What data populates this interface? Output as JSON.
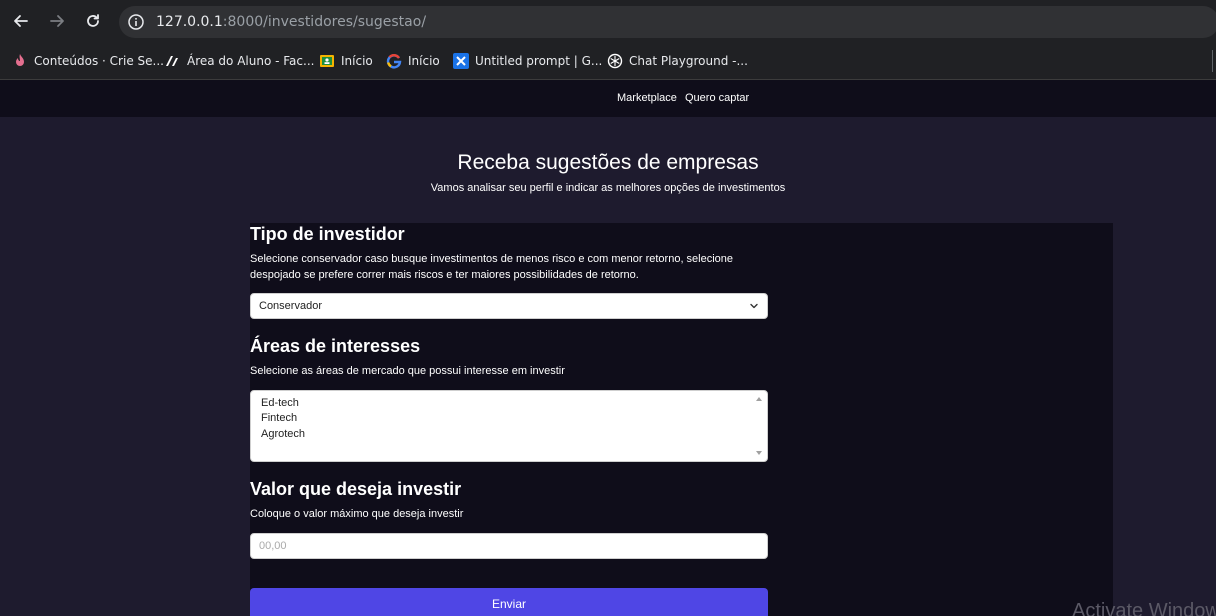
{
  "browser": {
    "url_host": "127.0.0.1",
    "url_path": ":8000/investidores/sugestao/",
    "bookmarks": [
      {
        "label": "Conteúdos · Crie Se...",
        "icon": "flame-icon"
      },
      {
        "label": "Área do Aluno - Fac...",
        "icon": "logo-icon"
      },
      {
        "label": "Início",
        "icon": "classroom-icon"
      },
      {
        "label": "Início",
        "icon": "google-icon"
      },
      {
        "label": "Untitled prompt | G...",
        "icon": "ai-studio-icon"
      },
      {
        "label": "Chat Playground -...",
        "icon": "openai-icon"
      }
    ]
  },
  "nav": {
    "links": [
      "Marketplace",
      "Quero captar"
    ]
  },
  "header": {
    "title": "Receba sugestões de empresas",
    "subtitle": "Vamos analisar seu perfil e indicar as melhores opções de investimentos"
  },
  "form": {
    "investor_type": {
      "title": "Tipo de investidor",
      "description": "Selecione conservador caso busque investimentos de menos risco e com menor retorno, selecione despojado se prefere correr mais riscos e ter maiores possibilidades de retorno.",
      "selected": "Conservador"
    },
    "areas": {
      "title": "Áreas de interesses",
      "description": "Selecione as áreas de mercado que possui interesse em investir",
      "options": [
        "Ed-tech",
        "Fintech",
        "Agrotech"
      ]
    },
    "amount": {
      "title": "Valor que deseja investir",
      "description": "Coloque o valor máximo que deseja investir",
      "placeholder": "00,00"
    },
    "submit_label": "Enviar"
  },
  "watermark": "Activate Windows",
  "colors": {
    "page_bg": "#1e1b2e",
    "panel_bg": "#0f0d1a",
    "accent": "#4f46e5"
  }
}
